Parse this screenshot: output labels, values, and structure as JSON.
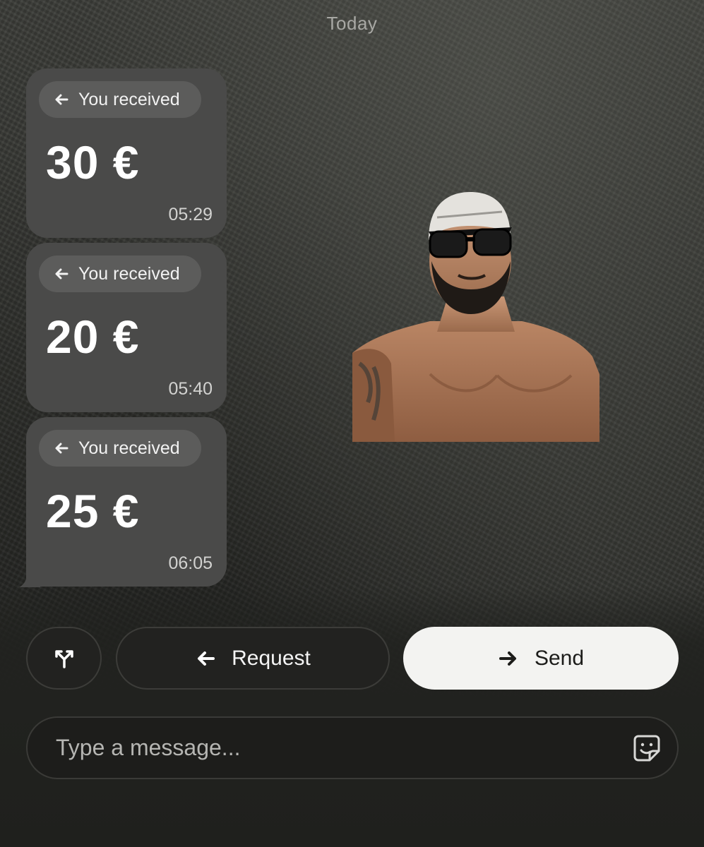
{
  "chat": {
    "day_label": "Today"
  },
  "messages": [
    {
      "label": "You received",
      "amount": "30 €",
      "time": "05:29"
    },
    {
      "label": "You received",
      "amount": "20 €",
      "time": "05:40"
    },
    {
      "label": "You received",
      "amount": "25 €",
      "time": "06:05"
    }
  ],
  "sticker": {
    "icon": "person-photo-sticker"
  },
  "actions": {
    "split_icon": "split-arrows-icon",
    "request_label": "Request",
    "send_label": "Send"
  },
  "composer": {
    "placeholder": "Type a message...",
    "sticker_icon": "sticker-icon"
  },
  "colors": {
    "bubble": "#4a4a49",
    "pill": "#5c5c5b",
    "send_button": "#f3f3f1",
    "dark_button": "#222220"
  }
}
